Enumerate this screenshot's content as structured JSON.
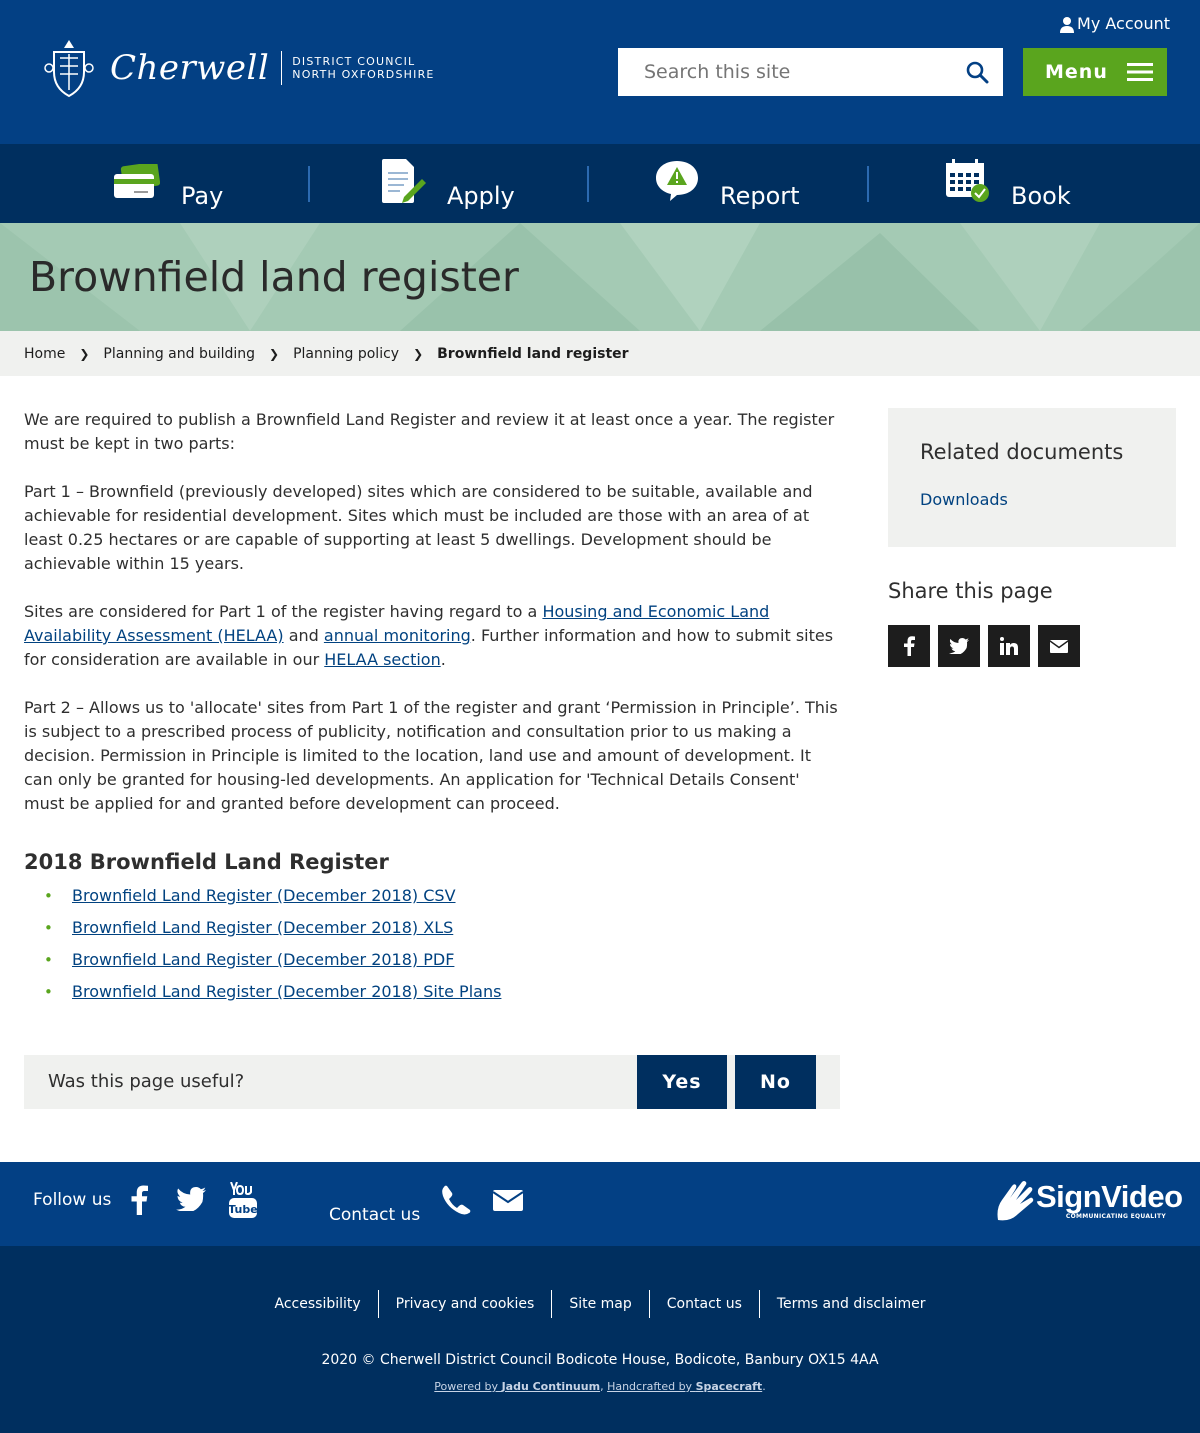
{
  "header": {
    "brand_name": "Cherwell",
    "brand_sub1": "DISTRICT COUNCIL",
    "brand_sub2": "NORTH OXFORDSHIRE",
    "my_account": "My Account",
    "search_placeholder": "Search this site",
    "menu_label": "Menu"
  },
  "quicknav": [
    {
      "label": "Pay",
      "icon": "credit-card-icon"
    },
    {
      "label": "Apply",
      "icon": "form-pen-icon"
    },
    {
      "label": "Report",
      "icon": "warning-bubble-icon"
    },
    {
      "label": "Book",
      "icon": "calendar-check-icon"
    }
  ],
  "page": {
    "title": "Brownfield land register"
  },
  "breadcrumb": [
    "Home",
    "Planning and building",
    "Planning policy",
    "Brownfield land register"
  ],
  "content": {
    "p1": "We are required to publish a Brownfield Land Register and review it at least once a year. The register must be kept in two parts:",
    "p2": "Part 1 – Brownfield (previously developed) sites which are considered to be suitable, available and achievable for residential development. Sites which must be included are those with an area of at least 0.25 hectares or are capable of supporting at least 5 dwellings. Development should be achievable within 15 years.",
    "p3_a": "Sites are considered for Part 1 of the register having regard to a ",
    "p3_link1": "Housing and Economic Land Availability Assessment (HELAA)",
    "p3_b": " and ",
    "p3_link2": "annual monitoring",
    "p3_c": ". Further information and how to submit sites for consideration are available in our ",
    "p3_link3": "HELAA section",
    "p3_d": ".",
    "p4": "Part 2 – Allows us to 'allocate' sites from Part 1 of the register and grant ‘Permission in Principle’. This is subject to a prescribed process of publicity, notification and consultation prior to us making a decision. Permission in Principle is limited to the location, land use and amount of development. It can only be granted for housing-led developments. An application for 'Technical Details Consent' must be applied for and granted before development can proceed.",
    "h2": "2018 Brownfield Land Register",
    "links": [
      "Brownfield Land Register (December 2018) CSV",
      "Brownfield Land Register (December 2018) XLS",
      "Brownfield Land Register (December 2018) PDF",
      "Brownfield Land Register (December 2018) Site Plans"
    ]
  },
  "feedback": {
    "question": "Was this page useful?",
    "yes": "Yes",
    "no": "No"
  },
  "sidebar": {
    "related_title": "Related documents",
    "related_link": "Downloads",
    "share_title": "Share this page",
    "share_icons": [
      "facebook-icon",
      "twitter-icon",
      "linkedin-icon",
      "email-icon"
    ]
  },
  "footer": {
    "follow_us": "Follow us",
    "contact_us": "Contact us",
    "signvideo_name": "SignVideo",
    "signvideo_tag": "COMMUNICATING EQUALITY",
    "links": [
      "Accessibility",
      "Privacy and cookies",
      "Site map",
      "Contact us",
      "Terms and disclaimer"
    ],
    "copyright": "2020 © Cherwell District Council Bodicote House, Bodicote, Banbury OX15 4AA",
    "powered_a": "Powered by ",
    "powered_jadu": "Jadu Continuum",
    "powered_b": ", ",
    "powered_c": "Handcrafted by ",
    "powered_spacecraft": "Spacecraft",
    "powered_d": "."
  },
  "colors": {
    "header_blue": "#034084",
    "nav_dark": "#002f5f",
    "accent_green": "#5aa51e",
    "banner_green": "#a4cab4",
    "link": "#014280"
  }
}
